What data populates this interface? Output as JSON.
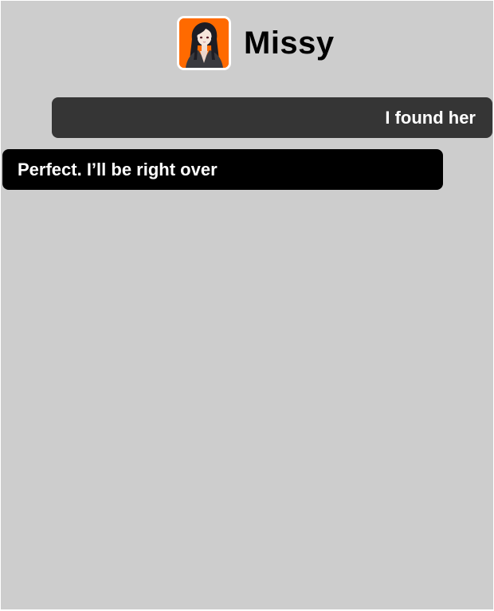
{
  "contact": {
    "name": "Missy",
    "avatar_icon": "anime-girl-portrait-avatar",
    "avatar_bg": "#ff6a00"
  },
  "messages": [
    {
      "direction": "sent",
      "text": "I found her",
      "bubble_color": "#353535"
    },
    {
      "direction": "received",
      "text": "Perfect. I’ll be right over",
      "bubble_color": "#000000"
    }
  ],
  "colors": {
    "background": "#cdcdcd",
    "text": "#ffffff",
    "name_text": "#000000"
  }
}
